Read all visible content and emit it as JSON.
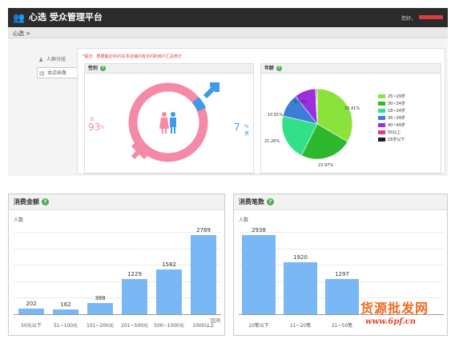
{
  "topbar": {
    "brand": "心选  受众管理平台",
    "greeting": "您好，"
  },
  "breadcrumb": "心选 >",
  "sidebar": {
    "items": [
      {
        "label": "人群分组"
      },
      {
        "label": "本店画像"
      }
    ]
  },
  "tip": "*提示：根据最近90内在本店铺内有访问的用户汇总统计",
  "gender": {
    "title": "性别",
    "female": {
      "label": "女",
      "value": "93",
      "unit": "%"
    },
    "male": {
      "value": "7",
      "unit": "%",
      "label": "男"
    },
    "colors": {
      "female": "#f48aa5",
      "male": "#3d9be9"
    }
  },
  "age": {
    "title": "年龄",
    "slices": [
      {
        "label": "25~29岁",
        "value": 33.41,
        "color": "#8be23a"
      },
      {
        "label": "30~34岁",
        "value": 23.97,
        "color": "#2db82d"
      },
      {
        "label": "18~24岁",
        "value": 21.26,
        "color": "#33e08a"
      },
      {
        "label": "35~39岁",
        "value": 10.81,
        "color": "#3a7ed8"
      },
      {
        "label": "40~49岁",
        "value": 9.72,
        "color": "#9b2fe0"
      },
      {
        "label": "50以上",
        "value": 0.5,
        "color": "#e03a8a"
      },
      {
        "label": "18岁以下",
        "value": 0.33,
        "color": "#1a1a40"
      }
    ],
    "pct_labels": [
      "33.41%",
      "23.97%",
      "21.26%",
      "10.81%",
      "9.72%"
    ]
  },
  "spend": {
    "title": "消费金额",
    "ylabel": "人数",
    "xunit": "区间",
    "chart_data": {
      "type": "bar",
      "categories": [
        "50元以下",
        "51~100元",
        "101~200元",
        "201~500元",
        "500~1000元",
        "1000以上"
      ],
      "values": [
        202,
        162,
        388,
        1229,
        1582,
        2789
      ],
      "ylim": [
        0,
        2900
      ]
    }
  },
  "count": {
    "title": "消费笔数",
    "ylabel": "人数",
    "chart_data": {
      "type": "bar",
      "categories": [
        "10笔以下",
        "11~20笔",
        "21~50笔"
      ],
      "values": [
        2938,
        1920,
        1297
      ],
      "ylim": [
        0,
        3050
      ]
    }
  },
  "watermark": {
    "line1": "货源批发网",
    "line2": "www.6pf.cn"
  }
}
